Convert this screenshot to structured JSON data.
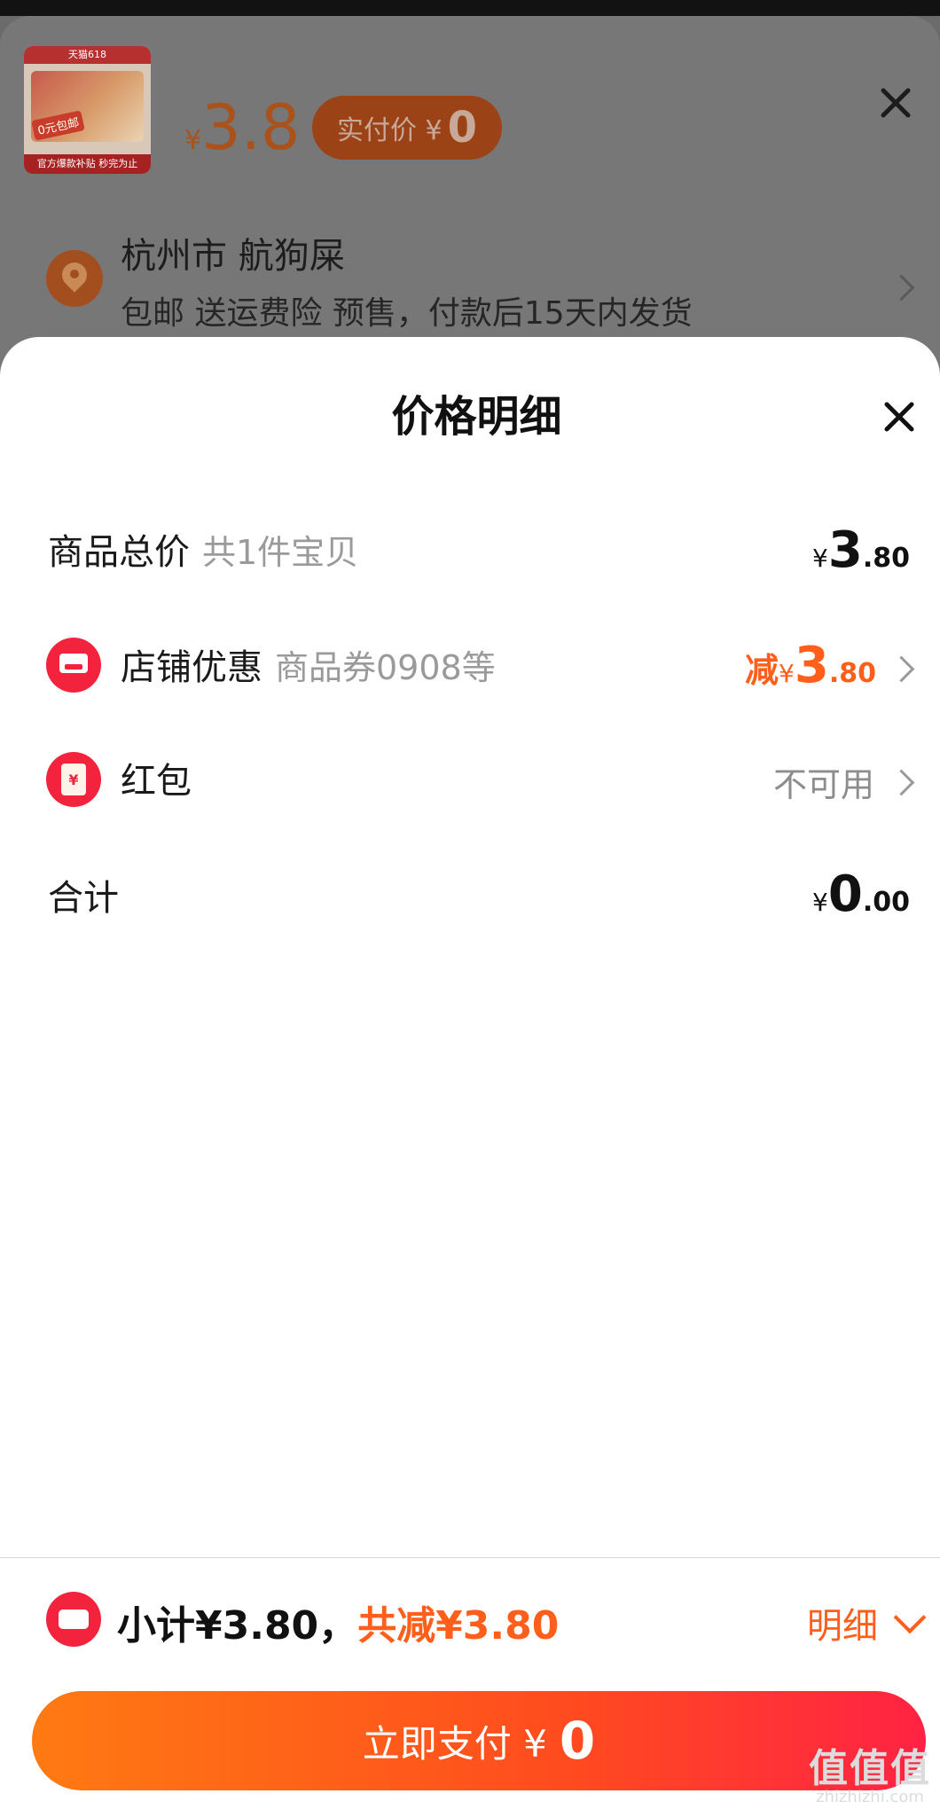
{
  "product": {
    "thumb_top_text": "天猫618",
    "thumb_badge": "0元包邮",
    "thumb_bottom_text": "官方爆款补贴 秒完为止",
    "price_symbol": "¥",
    "price": "3.8",
    "paid_label": "实付价 ¥",
    "paid_value": "0"
  },
  "address": {
    "line1": "杭州市 航狗屎",
    "line2": "包邮 送运费险 预售，付款后15天内发货"
  },
  "panel": {
    "title": "价格明细",
    "rows": [
      {
        "label": "商品总价",
        "sub": "共1件宝贝",
        "yen": "¥",
        "int": "3",
        "dec": ".80"
      },
      {
        "label": "店铺优惠",
        "sub": "商品券0908等",
        "prefix": "减",
        "yen": "¥",
        "int": "3",
        "dec": ".80"
      },
      {
        "label": "红包",
        "status": "不可用",
        "icon_text": "¥"
      },
      {
        "label": "合计",
        "yen": "¥",
        "int": "0",
        "dec": ".00"
      }
    ]
  },
  "footer": {
    "subtotal": "小计¥3.80，",
    "saved": "共减¥3.80",
    "detail": "明细",
    "pay_label": "立即支付 ¥",
    "pay_value": "0"
  },
  "watermark": {
    "main": "值值值",
    "sub": "zhizhizhi.com"
  },
  "colors": {
    "accent": "#ff5f1a",
    "red": "#f3233d"
  },
  "icons": [
    "location-pin-icon",
    "close-icon",
    "store-icon",
    "red-envelope-icon",
    "ticket-icon",
    "chevron-right-icon",
    "chevron-down-icon"
  ]
}
